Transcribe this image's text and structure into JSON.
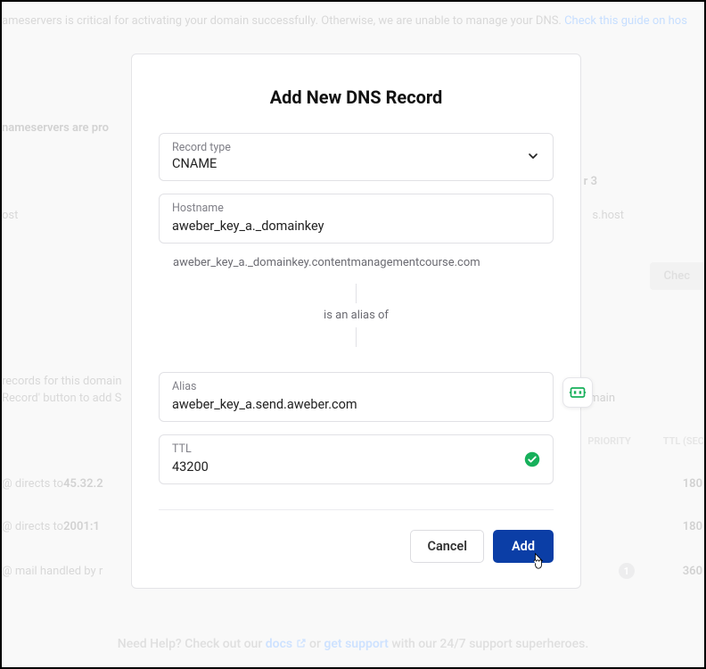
{
  "bg": {
    "notice_pre": "ameservers is critical for activating your domain successfully. Otherwise, we are unable to manage your DNS. ",
    "notice_link": "Check this guide on hos",
    "ns_propag": "nameservers are pro",
    "ns3": "r 3",
    "ns_host": "ost",
    "ns_host_r": "s.host",
    "check": "Chec",
    "rec_txt1": "records for this domain",
    "rec_txt2a": "Record' button to add S",
    "rec_txt2b": "omain",
    "th_priority": "PRIORITY",
    "th_ttl": "TTL (SEC",
    "r1_pre": "@ directs to ",
    "r1_ip": "45.32.2",
    "r1_ttl": "180",
    "r2_pre": "@ directs to ",
    "r2_ip": "2001:1",
    "r2_ttl": "180",
    "r3_pre": "@ mail handled by r",
    "r3_ttl": "360",
    "footer_a": "Need Help? Check out our ",
    "footer_docs": "docs",
    "footer_b": " or ",
    "footer_sup": "get support",
    "footer_c": " with our 24/7 support superheroes."
  },
  "modal": {
    "title": "Add New DNS Record",
    "record_type_label": "Record type",
    "record_type_value": "CNAME",
    "hostname_label": "Hostname",
    "hostname_value": "aweber_key_a._domainkey",
    "hostname_full": "aweber_key_a._domainkey.contentmanagementcourse.com",
    "alias_of": "is an alias of",
    "alias_label": "Alias",
    "alias_value": "aweber_key_a.send.aweber.com",
    "ttl_label": "TTL",
    "ttl_value": "43200",
    "cancel": "Cancel",
    "add": "Add"
  }
}
